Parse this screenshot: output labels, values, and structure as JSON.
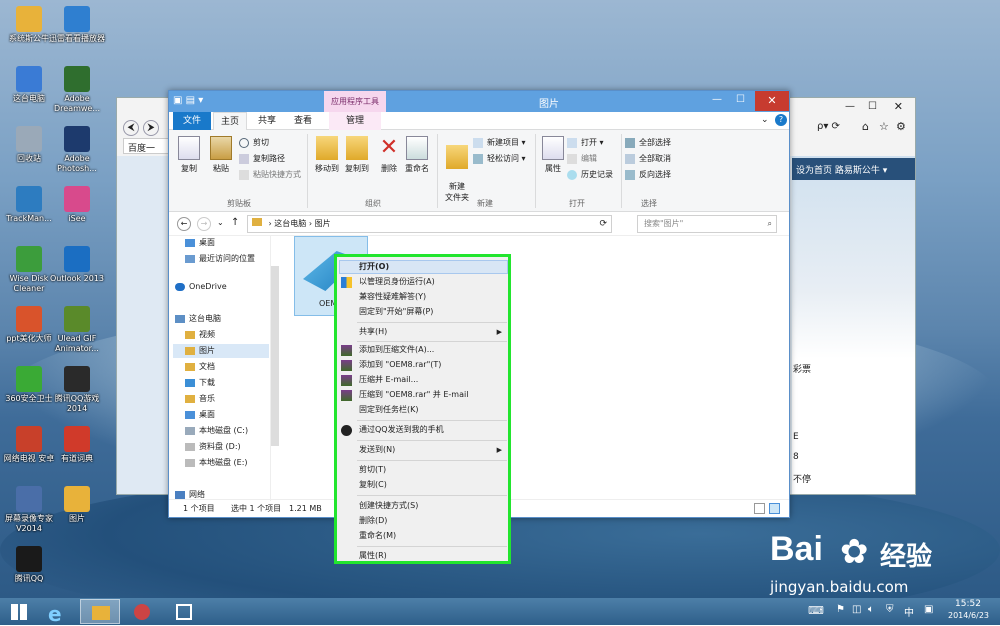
{
  "desktop": {
    "icons": [
      {
        "name": "desk-icon-luobo",
        "label": "系统斯公牛",
        "icon": "folder-icon",
        "color": "#e8b23a"
      },
      {
        "name": "desk-icon-xunlei",
        "label": "迅雷看看播放器",
        "icon": "player-icon",
        "color": "#2f7fd0"
      },
      {
        "name": "desk-icon-this-pc",
        "label": "这台电脑",
        "icon": "computer-icon",
        "color": "#3a7bd5"
      },
      {
        "name": "desk-icon-dreamweaver",
        "label": "Adobe Dreamwe...",
        "icon": "dreamweaver-icon",
        "color": "#2f6e2e"
      },
      {
        "name": "desk-icon-recycle",
        "label": "回收站",
        "icon": "recycle-bin-icon",
        "color": "#9aa9b8"
      },
      {
        "name": "desk-icon-photoshop",
        "label": "Adobe Photosh...",
        "icon": "photoshop-icon",
        "color": "#1d3a6d"
      },
      {
        "name": "desk-icon-trackmania",
        "label": "TrackMan...",
        "icon": "app-icon",
        "color": "#2d7cc0"
      },
      {
        "name": "desk-icon-isee",
        "label": "iSee",
        "icon": "app-icon",
        "color": "#d84a8c"
      },
      {
        "name": "desk-icon-wisedisk",
        "label": "Wise Disk Cleaner",
        "icon": "cleaner-icon",
        "color": "#3c9d3c"
      },
      {
        "name": "desk-icon-outlook",
        "label": "Outlook 2013",
        "icon": "outlook-icon",
        "color": "#1b6ec2"
      },
      {
        "name": "desk-icon-ppt",
        "label": "ppt美化大师",
        "icon": "app-icon",
        "color": "#d9532b"
      },
      {
        "name": "desk-icon-ulead",
        "label": "Ulead GIF Animator...",
        "icon": "app-icon",
        "color": "#5a8a2a"
      },
      {
        "name": "desk-icon-360",
        "label": "360安全卫士",
        "icon": "shield-icon",
        "color": "#3aaa35"
      },
      {
        "name": "desk-icon-qqgame",
        "label": "腾讯QQ游戏 2014",
        "icon": "qq-icon",
        "color": "#2a2a2a"
      },
      {
        "name": "desk-icon-kuaibo",
        "label": "网络电视 安卓",
        "icon": "app-icon",
        "color": "#c8402a"
      },
      {
        "name": "desk-icon-trans",
        "label": "有道词典",
        "icon": "app-icon",
        "color": "#d03a2a"
      },
      {
        "name": "desk-icon-mgtv",
        "label": "屏幕录像专家V2014",
        "icon": "app-icon",
        "color": "#4a6ea8"
      },
      {
        "name": "desk-icon-pictures",
        "label": "图片",
        "icon": "folder-icon",
        "color": "#e8b23a"
      },
      {
        "name": "desk-icon-qq",
        "label": "腾讯QQ",
        "icon": "qq-icon",
        "color": "#1a1a1a"
      }
    ]
  },
  "ie": {
    "tab_label": "百度一",
    "nav_links": "设为首页   路易斯公牛 ▾",
    "search_placeholder": "ρ▾ ⟳",
    "right_text_1": "彩票",
    "right_text_2": "E",
    "right_text_3": "8",
    "right_text_4": "不停"
  },
  "explorer": {
    "title": "图片",
    "context_tab_header": "应用程序工具",
    "tabs": {
      "file": "文件",
      "home": "主页",
      "share": "共享",
      "view": "查看",
      "manage": "管理"
    },
    "ribbon": {
      "copy": "复制",
      "paste": "粘贴",
      "cut": "剪切",
      "copy_path": "复制路径",
      "paste_shortcut": "粘贴快捷方式",
      "clipboard_group": "剪贴板",
      "move_to": "移动到",
      "copy_to": "复制到",
      "delete": "删除",
      "rename": "重命名",
      "organize_group": "组织",
      "new_folder": "新建\n文件夹",
      "new_item": "新建项目 ▾",
      "easy_access": "轻松访问 ▾",
      "new_group": "新建",
      "properties": "属性",
      "open": "打开 ▾",
      "edit": "编辑",
      "history": "历史记录",
      "open_group": "打开",
      "select_all": "全部选择",
      "select_none": "全部取消",
      "invert_selection": "反向选择",
      "select_group": "选择"
    },
    "address": {
      "path_1": "这台电脑",
      "path_2": "图片",
      "search_placeholder": "搜索\"图片\""
    },
    "nav": {
      "desktop": "桌面",
      "recent": "最近访问的位置",
      "onedrive": "OneDrive",
      "this_pc": "这台电脑",
      "videos": "视频",
      "pictures": "图片",
      "documents": "文档",
      "downloads": "下载",
      "music": "音乐",
      "desktop2": "桌面",
      "drive_c": "本地磁盘 (C:)",
      "drive_d": "资料盘 (D:)",
      "drive_e": "本地磁盘 (E:)",
      "network": "网络"
    },
    "file": {
      "label": "OEM"
    },
    "status": {
      "count": "1 个项目",
      "selected": "选中 1 个项目",
      "size": "1.21 MB"
    }
  },
  "context_menu": {
    "items": {
      "open": "打开(O)",
      "run_as_admin": "以管理员身份运行(A)",
      "compat": "兼容性疑难解答(Y)",
      "pin_start": "固定到\"开始\"屏幕(P)",
      "share": "共享(H)",
      "add_archive": "添加到压缩文件(A)...",
      "add_rar": "添加到 \"OEM8.rar\"(T)",
      "compress_email": "压缩并 E-mail...",
      "compress_rar_email": "压缩到 \"OEM8.rar\" 并 E-mail",
      "pin_taskbar": "固定到任务栏(K)",
      "send_qq": "通过QQ发送到我的手机",
      "send_to": "发送到(N)",
      "cut": "剪切(T)",
      "copy": "复制(C)",
      "create_shortcut": "创建快捷方式(S)",
      "delete": "删除(D)",
      "rename": "重命名(M)",
      "properties": "属性(R)"
    },
    "highlight_color": "#22e52e"
  },
  "watermark": {
    "brand": "Bai",
    "brand_cn": "经验",
    "url": "jingyan.baidu.com"
  },
  "taskbar": {
    "time": "15:52",
    "date": "2014/6/23",
    "ime": "中"
  }
}
